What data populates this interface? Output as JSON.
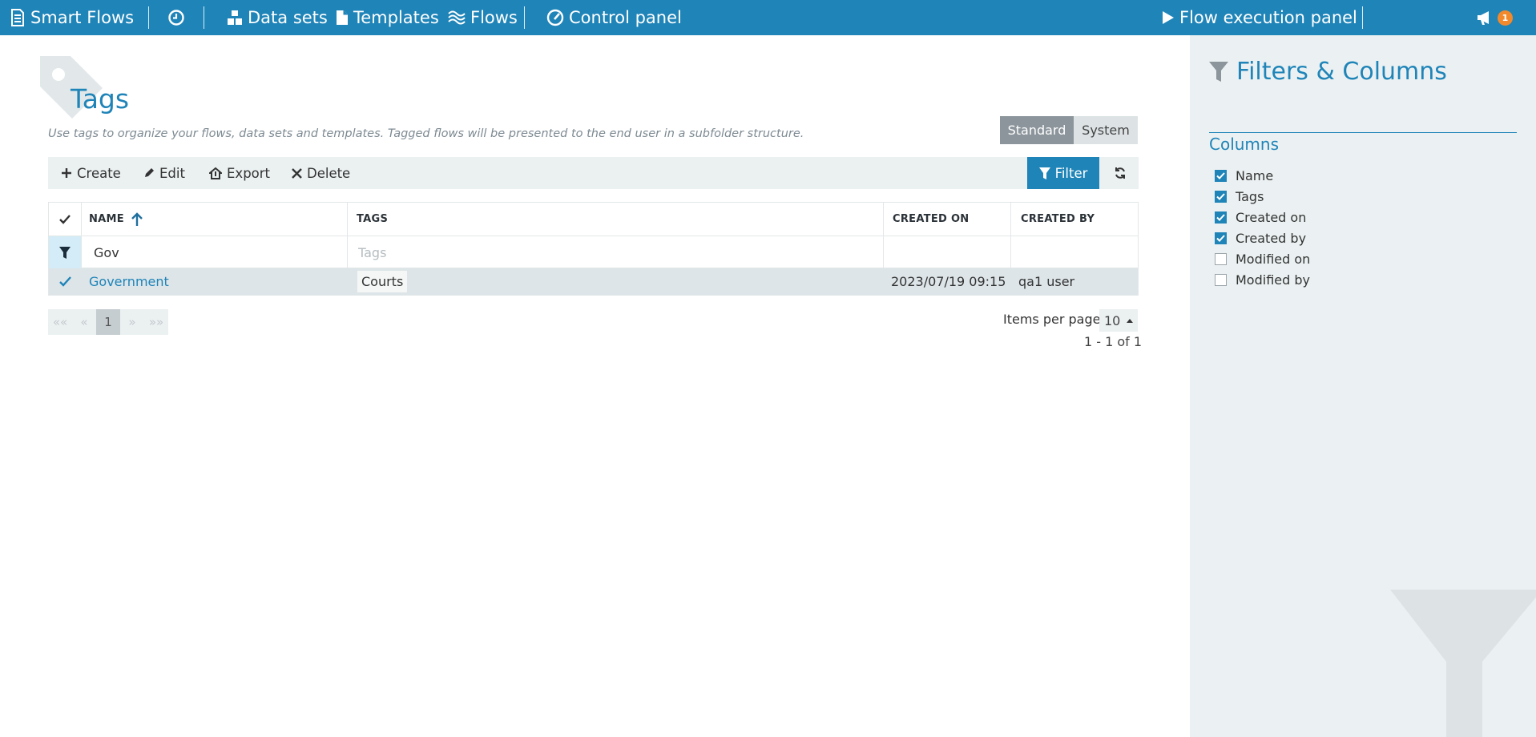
{
  "topbar": {
    "brand": "Smart Flows",
    "datasets": "Data sets",
    "templates": "Templates",
    "flows": "Flows",
    "control_panel": "Control panel",
    "flow_execution": "Flow execution panel",
    "notification_count": "1"
  },
  "page": {
    "title": "Tags",
    "description": "Use tags to organize your flows, data sets and templates. Tagged flows will be presented to the end user in a subfolder structure.",
    "toggle": {
      "standard": "Standard",
      "system": "System",
      "active": "Standard"
    }
  },
  "toolbar": {
    "create": "Create",
    "edit": "Edit",
    "export": "Export",
    "delete": "Delete",
    "filter": "Filter"
  },
  "table": {
    "columns": [
      "NAME",
      "TAGS",
      "CREATED ON",
      "CREATED BY"
    ],
    "sort": {
      "column": "NAME",
      "direction": "asc"
    },
    "filters": {
      "name_value": "Gov",
      "tags_placeholder": "Tags"
    },
    "rows": [
      {
        "name": "Government",
        "tags": [
          "Courts"
        ],
        "created_on": "2023/07/19 09:15",
        "created_by": "qa1 user",
        "selected": true
      }
    ]
  },
  "pager": {
    "first": "«« ",
    "prev": "«",
    "current_page": "1",
    "next": "»",
    "last": "»»",
    "items_per_page_label": "Items per page",
    "items_per_page": "10",
    "count_text": "1 - 1 of 1"
  },
  "side_panel": {
    "title": "Filters & Columns",
    "columns_heading": "Columns",
    "columns": [
      {
        "label": "Name",
        "checked": true
      },
      {
        "label": "Tags",
        "checked": true
      },
      {
        "label": "Created on",
        "checked": true
      },
      {
        "label": "Created by",
        "checked": true
      },
      {
        "label": "Modified on",
        "checked": false
      },
      {
        "label": "Modified by",
        "checked": false
      }
    ]
  },
  "colors": {
    "brand": "#1f84b8",
    "panel_bg": "#ebf1f2",
    "badge": "#f28a2c",
    "selected_row": "#dde5e8"
  }
}
